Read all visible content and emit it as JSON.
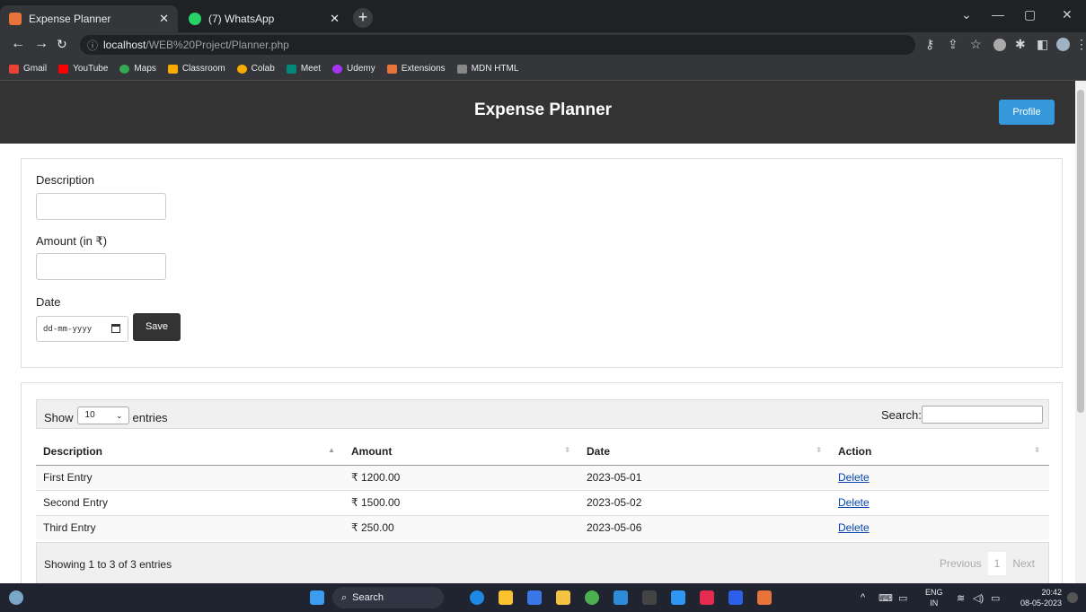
{
  "browser": {
    "tabs": [
      {
        "label": "Expense Planner",
        "active": true
      },
      {
        "label": "(7) WhatsApp",
        "active": false
      }
    ],
    "url_prefix": "localhost",
    "url_path": "/WEB%20Project/Planner.php",
    "bookmarks": [
      "Gmail",
      "YouTube",
      "Maps",
      "Classroom",
      "Colab",
      "Meet",
      "Udemy",
      "Extensions",
      "MDN HTML"
    ]
  },
  "header": {
    "title": "Expense Planner",
    "profile_label": "Profile"
  },
  "form": {
    "description_label": "Description",
    "amount_label": "Amount (in ₹)",
    "date_label": "Date",
    "date_placeholder": "dd-mm-yyyy",
    "save_label": "Save"
  },
  "table": {
    "show_label": "Show",
    "entries_value": "10",
    "entries_label": "entries",
    "search_label": "Search:",
    "columns": [
      "Description",
      "Amount",
      "Date",
      "Action"
    ],
    "rows": [
      {
        "description": "First Entry",
        "amount": "₹ 1200.00",
        "date": "2023-05-01",
        "action": "Delete"
      },
      {
        "description": "Second Entry",
        "amount": "₹ 1500.00",
        "date": "2023-05-02",
        "action": "Delete"
      },
      {
        "description": "Third Entry",
        "amount": "₹ 250.00",
        "date": "2023-05-06",
        "action": "Delete"
      }
    ],
    "info": "Showing 1 to 3 of 3 entries",
    "previous_label": "Previous",
    "page_label": "1",
    "next_label": "Next"
  },
  "taskbar": {
    "search_label": "Search",
    "lang": "ENG",
    "region": "IN",
    "time": "20:42",
    "date": "08-05-2023"
  }
}
